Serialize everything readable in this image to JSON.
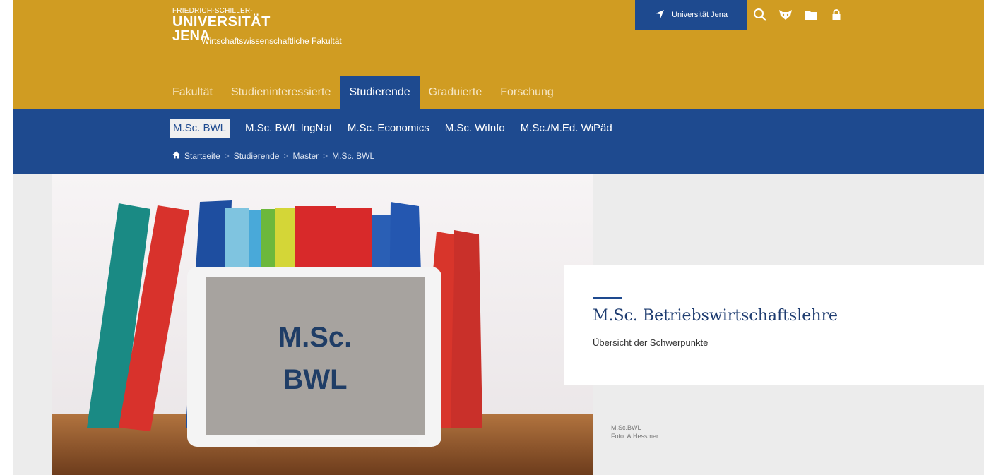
{
  "logo": {
    "line1": "FRIEDRICH-SCHILLER-",
    "line2": "UNIVERSITÄT",
    "line3": "JENA",
    "faculty": "Wirtschaftswissenschaftliche Fakultät"
  },
  "utility": {
    "university_button": "Universität Jena",
    "icons": [
      "location-arrow-icon",
      "search-icon",
      "fox-icon",
      "folder-icon",
      "lock-icon"
    ]
  },
  "main_nav": [
    {
      "label": "Fakultät"
    },
    {
      "label": "Studieninteressierte"
    },
    {
      "label": "Studierende",
      "active": true
    },
    {
      "label": "Graduierte"
    },
    {
      "label": "Forschung"
    }
  ],
  "sub_nav": [
    {
      "label": "M.Sc. BWL",
      "active": true
    },
    {
      "label": "M.Sc. BWL IngNat"
    },
    {
      "label": "M.Sc. Economics"
    },
    {
      "label": "M.Sc. WiInfo"
    },
    {
      "label": "M.Sc./M.Ed. WiPäd"
    }
  ],
  "breadcrumb": {
    "home": "Startseite",
    "items": [
      "Studierende",
      "Master",
      "M.Sc. BWL"
    ]
  },
  "hero": {
    "tablet_line1": "M.Sc.",
    "tablet_line2": "BWL",
    "image_desc": "Bücher und Tablet"
  },
  "card": {
    "title": "M.Sc. Betriebswirtschaftslehre",
    "subtitle": "Übersicht der Schwerpunkte"
  },
  "credit": {
    "line1": "M.Sc.BWL",
    "line2": "Foto: A.Hessmer"
  },
  "colors": {
    "gold": "#d09c22",
    "blue": "#1e4a8f",
    "grey": "#ececec"
  }
}
